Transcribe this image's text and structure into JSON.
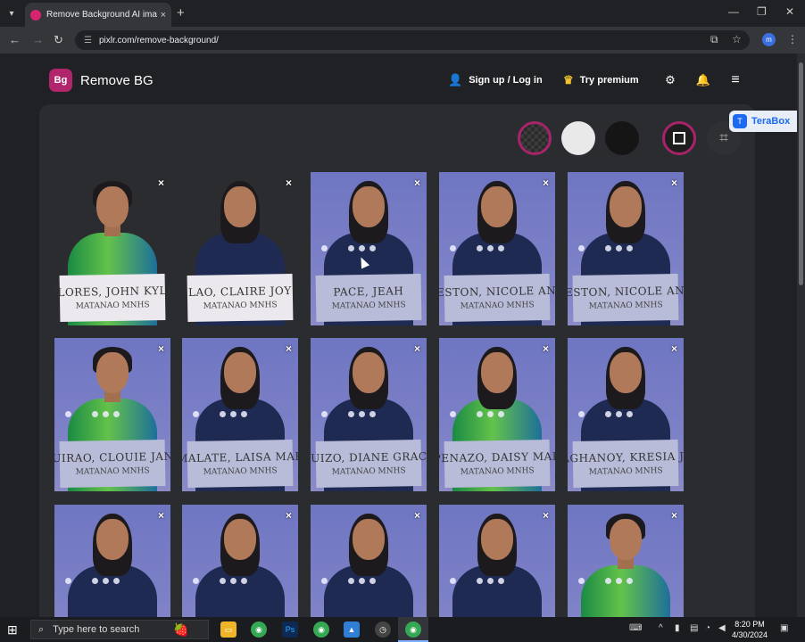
{
  "browser": {
    "tab_title": "Remove Background AI image",
    "tab_close": "×",
    "new_tab": "+",
    "url": "pixlr.com/remove-background/",
    "window_controls": {
      "minimize": "—",
      "maximize": "❐",
      "close": "✕"
    }
  },
  "header": {
    "logo_text": "Bg",
    "brand_name": "Remove BG",
    "sign_in": "Sign up / Log in",
    "premium": "Try premium"
  },
  "terabox": {
    "logo": "T",
    "name": "TeraBox"
  },
  "thumbnails": [
    {
      "name": "FLORES, JOHN KYLE",
      "school": "MATANAO MNHS",
      "bg": "dark",
      "gender": "m",
      "close": "×"
    },
    {
      "name": "LAO, CLAIRE JOY",
      "school": "MATANAO MNHS",
      "bg": "dark",
      "gender": "f",
      "close": "×"
    },
    {
      "name": "PACE, JEAH",
      "school": "MATANAO MNHS",
      "bg": "blue",
      "gender": "f",
      "close": "×"
    },
    {
      "name": "RESTON, NICOLE ANN",
      "school": "MATANAO MNHS",
      "bg": "blue",
      "gender": "f",
      "close": "×"
    },
    {
      "name": "RESTON, NICOLE ANN",
      "school": "MATANAO MNHS",
      "bg": "blue",
      "gender": "f",
      "close": "×"
    },
    {
      "name": "QUIRAO, CLOUIE JANE",
      "school": "MATANAO MNHS",
      "bg": "blue",
      "gender": "m",
      "close": "×"
    },
    {
      "name": "MALATE, LAISA MAE",
      "school": "MATANAO MNHS",
      "bg": "blue",
      "gender": "f",
      "close": "×"
    },
    {
      "name": "QUIZO, DIANE GRACE",
      "school": "MATANAO MNHS",
      "bg": "blue",
      "gender": "f",
      "close": "×"
    },
    {
      "name": "PENAZO, DAISY MAE",
      "school": "MATANAO MNHS",
      "bg": "blue",
      "gender": "f",
      "close": "×"
    },
    {
      "name": "MAGHANOY, KRESIA JOY",
      "school": "MATANAO MNHS",
      "bg": "blue",
      "gender": "f",
      "close": "×"
    },
    {
      "name": "",
      "school": "",
      "bg": "blue",
      "gender": "f",
      "close": "×"
    },
    {
      "name": "",
      "school": "",
      "bg": "blue",
      "gender": "f",
      "close": "×"
    },
    {
      "name": "",
      "school": "",
      "bg": "blue",
      "gender": "f",
      "close": "×"
    },
    {
      "name": "",
      "school": "",
      "bg": "blue",
      "gender": "f",
      "close": "×"
    },
    {
      "name": "",
      "school": "",
      "bg": "blue",
      "gender": "m",
      "close": "×"
    }
  ],
  "taskbar": {
    "search_placeholder": "Type here to search",
    "time": "8:20 PM",
    "date": "4/30/2024"
  },
  "colors": {
    "accent": "#a8246a",
    "terabox_blue": "#1b6af0"
  }
}
